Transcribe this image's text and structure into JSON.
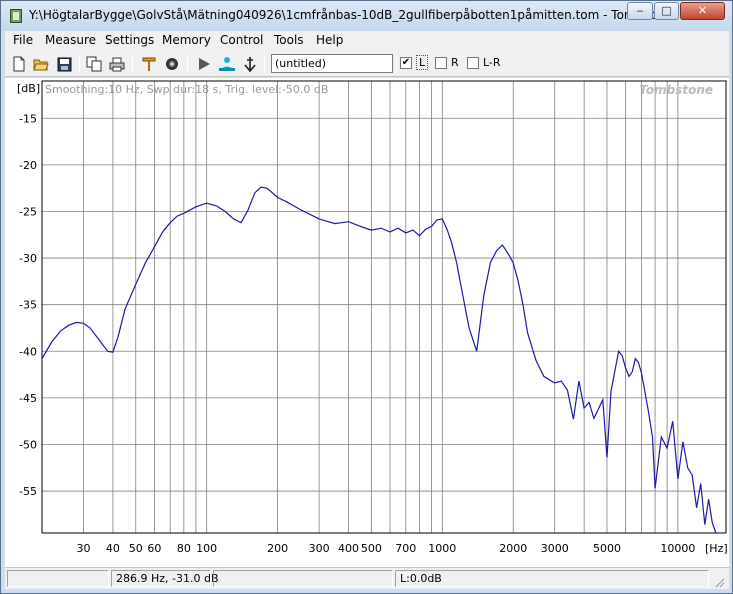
{
  "window": {
    "title": "Y:\\HögtalarBygge\\GolvStå\\Mätning040926\\1cmfrånbas-10dB_2gullfiberpåbotten1påmitten.tom - TombStone",
    "minimize_label": "‒",
    "maximize_label": "□",
    "close_label": "✕"
  },
  "menu": [
    "File",
    "Measure",
    "Settings",
    "Memory",
    "Control",
    "Tools",
    "Help"
  ],
  "toolbar": {
    "name_value": "(untitled)",
    "check_l_label": "L",
    "check_r_label": "R",
    "check_lr_label": "L-R",
    "check_l_checked": true
  },
  "graph": {
    "info_text": "Smoothing:10 Hz, Swp dur:18 s, Trig. level:-50.0 dB",
    "watermark": "Tombstone",
    "y_unit": "[dB]",
    "x_unit": "[Hz]",
    "curve_color": "#1a1aa8",
    "grid_color": "#808080"
  },
  "status": {
    "cursor": "286.9 Hz, -31.0 dB",
    "level": "L:0.0dB"
  },
  "chart_data": {
    "type": "line",
    "xscale": "log",
    "xlim": [
      20,
      16000
    ],
    "ylim": [
      -59.5,
      -11
    ],
    "x_ticks": [
      30,
      40,
      50,
      60,
      80,
      100,
      200,
      300,
      400,
      500,
      700,
      1000,
      2000,
      3000,
      5000,
      10000
    ],
    "x_tick_labels": [
      "30",
      "40",
      "50",
      "60",
      "80",
      "100",
      "200",
      "300",
      "400",
      "500",
      "700",
      "1000",
      "2000",
      "3000",
      "5000",
      "10000"
    ],
    "y_ticks": [
      -15,
      -20,
      -25,
      -30,
      -35,
      -40,
      -45,
      -50,
      -55
    ],
    "y_tick_labels": [
      "-15",
      "-20",
      "-25",
      "-30",
      "-35",
      "-40",
      "-45",
      "-50",
      "-55"
    ],
    "grid": true,
    "series": [
      {
        "x": [
          20,
          22,
          24,
          26,
          28,
          30,
          32,
          35,
          38,
          40,
          42,
          45,
          50,
          55,
          60,
          65,
          70,
          75,
          80,
          90,
          100,
          110,
          120,
          130,
          140,
          150,
          160,
          170,
          180,
          190,
          200,
          220,
          250,
          300,
          350,
          400,
          450,
          500,
          550,
          600,
          650,
          700,
          750,
          800,
          850,
          900,
          950,
          1000,
          1050,
          1100,
          1150,
          1200,
          1300,
          1400,
          1500,
          1600,
          1700,
          1800,
          1900,
          2000,
          2100,
          2200,
          2300,
          2500,
          2700,
          3000,
          3200,
          3400,
          3600,
          3800,
          4000,
          4200,
          4400,
          4600,
          4800,
          5000,
          5200,
          5400,
          5600,
          5800,
          6000,
          6200,
          6400,
          6600,
          6800,
          7000,
          7200,
          7500,
          7800,
          8000,
          8500,
          9000,
          9500,
          10000,
          10500,
          11000,
          11500,
          12000,
          12500,
          13000,
          13500,
          14000,
          14500,
          15000
        ],
        "y": [
          -40.8,
          -39,
          -37.8,
          -37.2,
          -36.9,
          -37,
          -37.5,
          -38.8,
          -40,
          -40.1,
          -38.5,
          -35.5,
          -32.8,
          -30.5,
          -28.8,
          -27.2,
          -26.2,
          -25.5,
          -25.2,
          -24.5,
          -24.1,
          -24.4,
          -25,
          -25.8,
          -26.2,
          -24.8,
          -23,
          -22.4,
          -22.5,
          -23,
          -23.5,
          -24,
          -24.8,
          -25.8,
          -26.3,
          -26.1,
          -26.6,
          -27,
          -26.8,
          -27.2,
          -26.8,
          -27.3,
          -27,
          -27.6,
          -26.9,
          -26.6,
          -25.9,
          -25.8,
          -27,
          -28.5,
          -30.5,
          -33,
          -37.5,
          -40,
          -34,
          -30.5,
          -29.2,
          -28.6,
          -29.5,
          -30.5,
          -32.5,
          -35,
          -38,
          -41,
          -42.7,
          -43.4,
          -43.2,
          -44.2,
          -47.3,
          -43.2,
          -46.1,
          -45.5,
          -47.2,
          -46.2,
          -45.2,
          -51.4,
          -44.3,
          -42.1,
          -40,
          -40.5,
          -41.8,
          -42.7,
          -42.2,
          -40.8,
          -41.2,
          -42.3,
          -44,
          -46.5,
          -49.2,
          -54.7,
          -49.2,
          -50.4,
          -47.5,
          -53.7,
          -49.7,
          -52.5,
          -53.3,
          -56.8,
          -54.2,
          -58.6,
          -55.9,
          -58.4,
          -59.5,
          -59.5
        ]
      }
    ]
  }
}
